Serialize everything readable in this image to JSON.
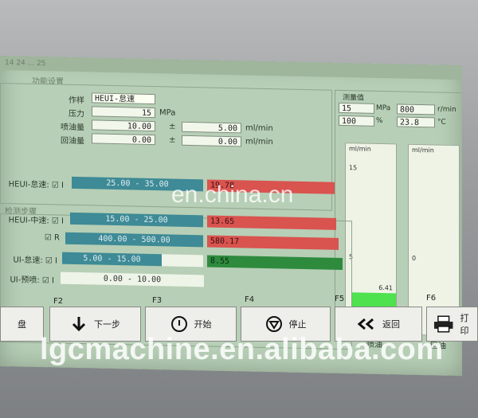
{
  "titlebar": "14 24 ... 25",
  "section_title": "功能设置",
  "params": {
    "mode_label": "作样",
    "mode_value": "HEUI-怠速",
    "pressure_label": "压力",
    "pressure_value": "15",
    "pressure_unit": "MPa",
    "inject_label": "喷油量",
    "inject_value": "10.00",
    "inject_tol": "5.00",
    "inject_unit": "ml/min",
    "return_label": "回油量",
    "return_value": "0.00",
    "return_tol": "0.00",
    "return_unit": "ml/min",
    "pm": "±"
  },
  "measure": {
    "title": "测量值",
    "pressure": "15",
    "pressure_unit": "MPa",
    "speed": "800",
    "speed_unit": "r/min",
    "percent": "100",
    "percent_unit": "%",
    "temp": "23.8",
    "temp_unit": "°C"
  },
  "results_title": "检测步骤",
  "rows": [
    {
      "label": "HEUI-怠速: ☑ I",
      "range": "25.00 - 35.00",
      "value": "19.78",
      "status": "fail"
    },
    {
      "label": "HEUI-中速: ☑ I",
      "range": "15.00 - 25.00",
      "value": "13.65",
      "status": "fail"
    },
    {
      "label": "☑ R",
      "range": "400.00 - 500.00",
      "value": "580.17",
      "status": "fail"
    },
    {
      "label": "UI-怠速: ☑ I",
      "range": "5.00 - 15.00",
      "value": "8.55",
      "status": "pass"
    },
    {
      "label": "UI-预喷: ☑ I",
      "range": "0.00 - 10.00",
      "value": "",
      "status": "none"
    }
  ],
  "charts": {
    "unit": "ml/min",
    "inject": {
      "label": "喷油",
      "top_tick": "15",
      "mid_tick": "5",
      "value": 6.41,
      "value_text": "6.41",
      "max": 15
    },
    "return": {
      "label": "回油",
      "top_tick": "",
      "mid_tick": "0",
      "value": 0,
      "value_text": "",
      "max": 15
    }
  },
  "fkeys": [
    "F2",
    "F3",
    "F4",
    "F5",
    "F6"
  ],
  "buttons": {
    "disk": "盘",
    "next": "下一步",
    "start": "开始",
    "stop": "停止",
    "back": "返回",
    "print": "打印"
  },
  "watermarks": {
    "center": "en.china.cn",
    "bottom": "lgcmachine.en.alibaba.com"
  },
  "colors": {
    "fail": "#d9534f",
    "pass": "#2e8b3e",
    "chart_fill": "#4ee24e"
  }
}
